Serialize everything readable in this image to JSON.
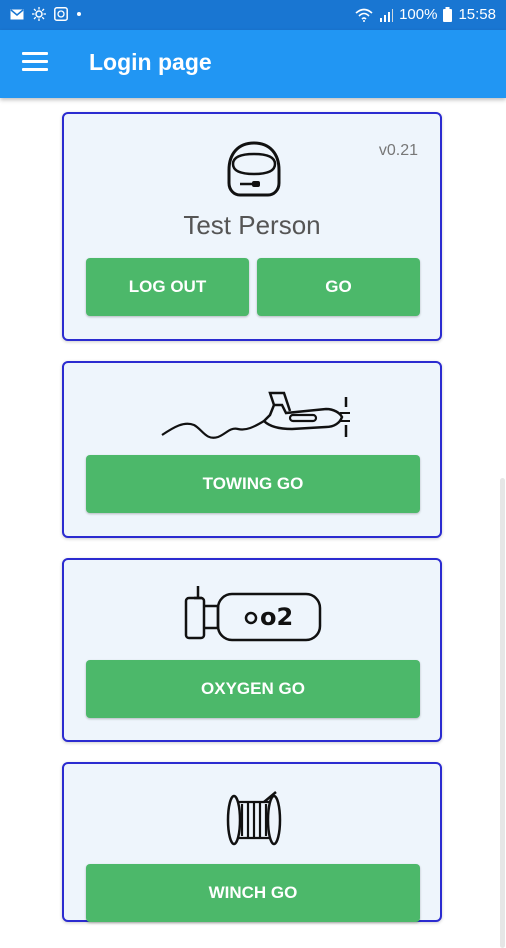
{
  "status_bar": {
    "battery": "100%",
    "time": "15:58",
    "icons": [
      "mail-icon",
      "brightness-icon",
      "shield-icon",
      "dot-icon",
      "wifi-icon",
      "signal-icon",
      "battery-icon"
    ]
  },
  "app_bar": {
    "title": "Login page",
    "menu_icon": "hamburger-icon"
  },
  "login_card": {
    "version": "v0.21",
    "name": "Test Person",
    "icon": "pilot-helmet-icon",
    "logout_label": "LOG OUT",
    "go_label": "GO"
  },
  "towing_card": {
    "icon": "towplane-icon",
    "button_label": "TOWING GO"
  },
  "oxygen_card": {
    "icon": "oxygen-bottle-icon",
    "icon_text": "o2",
    "button_label": "OXYGEN GO"
  },
  "winch_card": {
    "icon": "winch-drum-icon",
    "button_label": "WINCH GO"
  },
  "colors": {
    "status_bar": "#1976d2",
    "app_bar": "#2196f3",
    "card_border": "#2b2bd0",
    "card_bg": "#eef5fc",
    "button": "#4cb86a"
  }
}
